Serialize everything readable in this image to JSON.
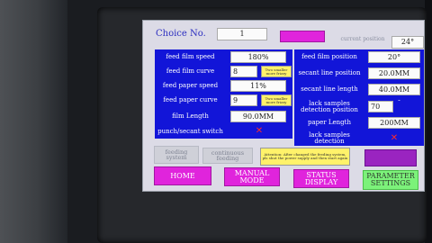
{
  "header": {
    "choice_label": "Choice No.",
    "choice_value": "1",
    "current_position_label": "current position",
    "current_position_value": "24°"
  },
  "params": {
    "feed_film_speed": {
      "label": "feed film speed",
      "value": "180%"
    },
    "feed_film_curve": {
      "label": "feed film curve",
      "value": "8",
      "note": "Two smaller more frizzy"
    },
    "feed_paper_speed": {
      "label": "feed paper speed",
      "value": "11%"
    },
    "feed_paper_curve": {
      "label": "feed paper curve",
      "value": "9",
      "note": "Two smaller more frizzy"
    },
    "film_length": {
      "label": "film Length",
      "value": "90.0MM"
    },
    "punch_secant_switch": {
      "label": "punch/secant switch"
    },
    "feed_film_position": {
      "label": "feed film position",
      "value": "20°"
    },
    "secant_line_position": {
      "label": "secant line position",
      "value": "20.0MM"
    },
    "secant_line_length": {
      "label": "secant line length",
      "value": "40.0MM"
    },
    "lack_samples_detection_position": {
      "label": "lack samples detection position",
      "value": "70",
      "unit": "°"
    },
    "paper_length": {
      "label": "paper Length",
      "value": "200MM"
    },
    "lack_samples_detection": {
      "label": "lack samples detection"
    }
  },
  "feeding": {
    "feeding_system": "feeding system",
    "continuous_feeding": "continuous feeding",
    "notice": "Attention: After changed the feeding system, pls shut the power supply and then start again"
  },
  "buttons": {
    "home": "HOME",
    "manual_mode": "MANUAL MODE",
    "status_display": "STATUS DISPLAY",
    "parameter_settings": "PARAMETER SETTINGS"
  },
  "colors": {
    "accent_blue": "#1215d8",
    "magenta": "#e024dc",
    "alarm_red": "#ff2a2a",
    "settings_green": "#7cf27a"
  },
  "icons": {
    "disabled_switch": "x-mark",
    "degree_unit": "degree"
  }
}
